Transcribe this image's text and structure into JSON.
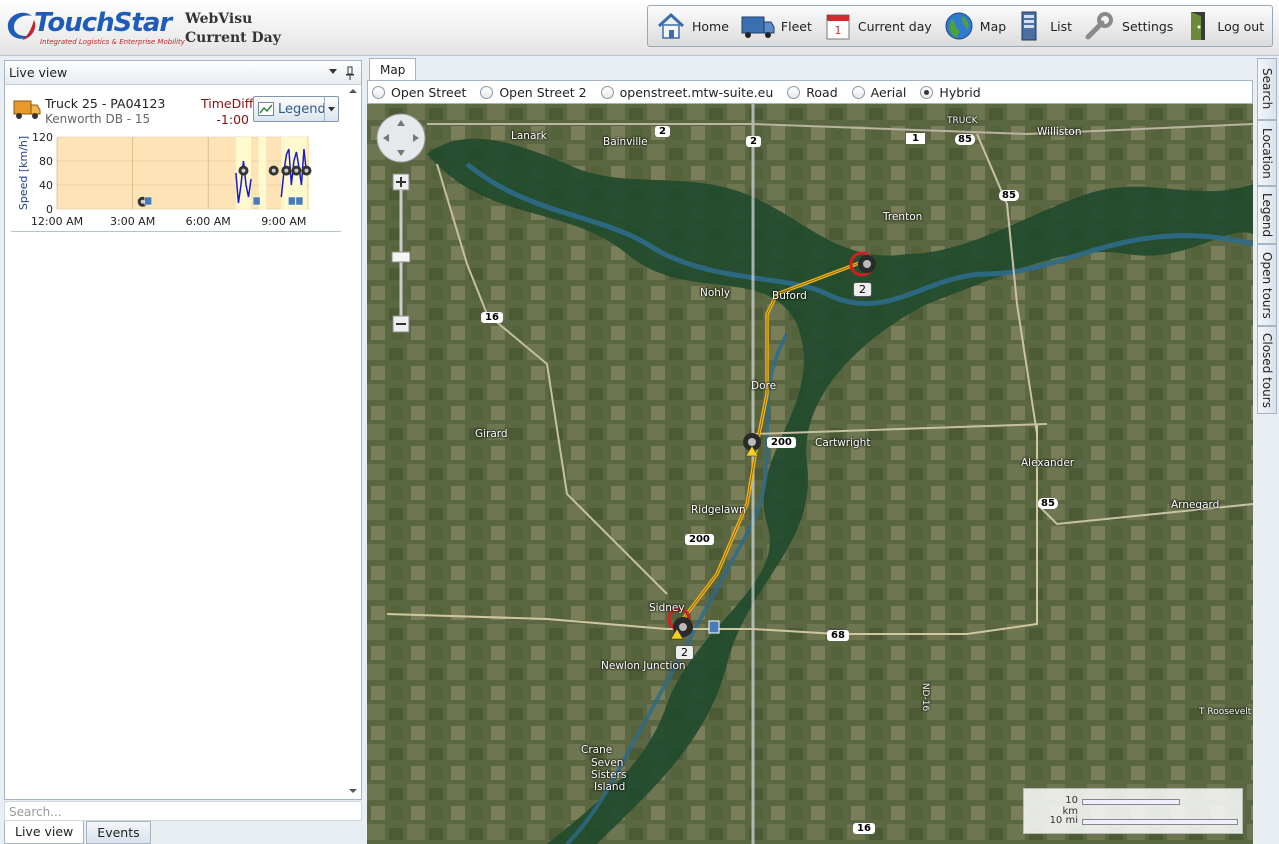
{
  "app": {
    "logo_text": "TouchStar",
    "logo_tagline": "Integrated Logistics & Enterprise Mobility",
    "title_line1": "WebVisu",
    "title_line2": "Current Day"
  },
  "toolbar": {
    "items": [
      {
        "label": "Home",
        "icon": "home-icon"
      },
      {
        "label": "Fleet",
        "icon": "truck-icon"
      },
      {
        "label": "Current day",
        "icon": "calendar-icon"
      },
      {
        "label": "Map",
        "icon": "globe-icon"
      },
      {
        "label": "List",
        "icon": "server-list-icon"
      },
      {
        "label": "Settings",
        "icon": "wrench-icon"
      },
      {
        "label": "Log out",
        "icon": "logout-door-icon"
      }
    ]
  },
  "left_panel": {
    "title": "Live view",
    "vehicle": {
      "name": "Truck 25 - PA04123",
      "subtitle": "Kenworth DB - 15",
      "timediff_label": "TimeDiff",
      "timediff_value": "-1:00",
      "legend_label": "Legend"
    },
    "search_placeholder": "Search...",
    "tabs": [
      {
        "label": "Live view",
        "active": true
      },
      {
        "label": "Events",
        "active": false
      }
    ]
  },
  "chart_data": {
    "type": "line",
    "ylabel": "Speed [km/h]",
    "xlabel": "",
    "yticks": [
      0,
      40,
      80,
      120
    ],
    "ylim": [
      0,
      120
    ],
    "xticks": [
      "12:00 AM",
      "3:00 AM",
      "6:00 AM",
      "9:00 AM"
    ],
    "series": [
      {
        "x_hours": [
          7.1,
          7.2,
          7.3,
          7.4,
          7.5,
          7.6,
          7.7
        ],
        "values": [
          60,
          10,
          40,
          80,
          40,
          20,
          50
        ]
      },
      {
        "x_hours": [
          8.9,
          9.0,
          9.1,
          9.2,
          9.3,
          9.4,
          9.5,
          9.6,
          9.7,
          9.8,
          9.9
        ],
        "values": [
          20,
          60,
          90,
          100,
          40,
          80,
          95,
          70,
          40,
          100,
          60
        ]
      }
    ]
  },
  "map": {
    "tab_label": "Map",
    "layers": [
      {
        "label": "Open Street",
        "selected": false
      },
      {
        "label": "Open Street 2",
        "selected": false
      },
      {
        "label": "openstreet.mtw-suite.eu",
        "selected": false
      },
      {
        "label": "Road",
        "selected": false
      },
      {
        "label": "Aerial",
        "selected": false
      },
      {
        "label": "Hybrid",
        "selected": true
      }
    ],
    "places": [
      "Lanark",
      "Bainville",
      "TRUCK",
      "Williston",
      "Trenton",
      "Nohly",
      "Buford",
      "Dore",
      "Girard",
      "Cartwright",
      "Alexander",
      "Arnegard",
      "Ridgelawn",
      "Sidney",
      "Newlon Junction",
      "Crane",
      "Seven",
      "Sisters",
      "Island",
      "ND-16",
      "T Roosevelt"
    ],
    "routes": [
      "2",
      "2",
      "1",
      "85",
      "85",
      "16",
      "200",
      "200",
      "85",
      "68",
      "16"
    ],
    "markers": [
      "2",
      "2"
    ],
    "scale": {
      "km": "10 km",
      "mi": "10 mi"
    }
  },
  "side_tabs": [
    "Search",
    "Location",
    "Legend",
    "Open tours",
    "Closed tours"
  ],
  "colors": {
    "brand_blue": "#1f5cb8",
    "brand_red": "#c0262d",
    "route": "#f3b416",
    "timediff": "#8b1010"
  }
}
